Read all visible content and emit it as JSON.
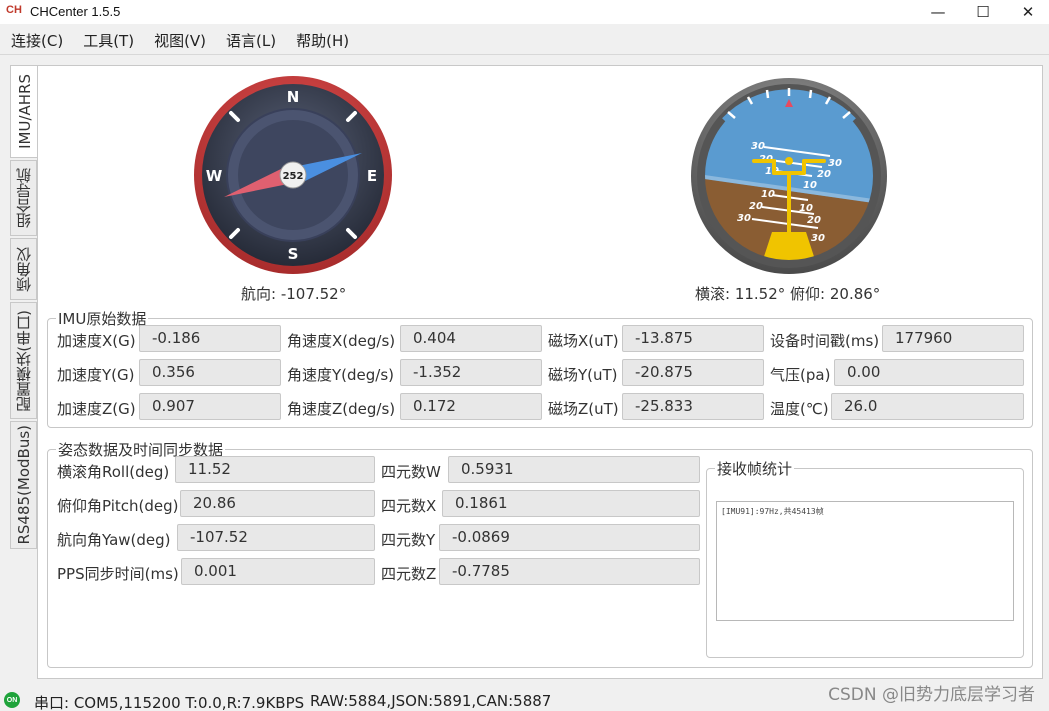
{
  "window": {
    "logo": "CH",
    "title": "CHCenter 1.5.5",
    "minimize_glyph": "—",
    "maximize_glyph": "☐",
    "close_glyph": "✕"
  },
  "menu": [
    "连接(C)",
    "工具(T)",
    "视图(V)",
    "语言(L)",
    "帮助(H)"
  ],
  "tabs": [
    "IMU/AHRS",
    "组合导航",
    "倾角仪",
    "配置模块(串口)",
    "RS485(ModBus)"
  ],
  "compass": {
    "heading_label": "航向: -107.52°",
    "center_value": "252",
    "cardinals": {
      "n": "N",
      "s": "S",
      "e": "E",
      "w": "W"
    }
  },
  "attitude": {
    "label": "横滚:   11.52° 俯仰:   20.86°",
    "pitch_ticks": [
      "30",
      "20",
      "10",
      "10",
      "20",
      "30",
      "30",
      "20",
      "10",
      "10",
      "20",
      "30"
    ]
  },
  "imu_raw": {
    "legend": "IMU原始数据",
    "rows": [
      [
        {
          "label": "加速度X(G)",
          "value": "-0.186"
        },
        {
          "label": "角速度X(deg/s)",
          "value": "0.404"
        },
        {
          "label": "磁场X(uT)",
          "value": "-13.875"
        },
        {
          "label": "设备时间戳(ms)",
          "value": "177960"
        }
      ],
      [
        {
          "label": "加速度Y(G)",
          "value": "0.356"
        },
        {
          "label": "角速度Y(deg/s)",
          "value": "-1.352"
        },
        {
          "label": "磁场Y(uT)",
          "value": "-20.875"
        },
        {
          "label": "气压(pa)",
          "value": "0.00"
        }
      ],
      [
        {
          "label": "加速度Z(G)",
          "value": "0.907"
        },
        {
          "label": "角速度Z(deg/s)",
          "value": "0.172"
        },
        {
          "label": "磁场Z(uT)",
          "value": "-25.833"
        },
        {
          "label": "温度(℃)",
          "value": "26.0"
        }
      ]
    ]
  },
  "attitude_data": {
    "legend": "姿态数据及时间同步数据",
    "rows": [
      [
        {
          "label": "横滚角Roll(deg)",
          "value": "11.52"
        },
        {
          "label": "四元数W",
          "value": "0.5931"
        }
      ],
      [
        {
          "label": "俯仰角Pitch(deg)",
          "value": "20.86"
        },
        {
          "label": "四元数X",
          "value": "0.1861"
        }
      ],
      [
        {
          "label": "航向角Yaw(deg)",
          "value": "-107.52"
        },
        {
          "label": "四元数Y",
          "value": "-0.0869"
        }
      ],
      [
        {
          "label": "PPS同步时间(ms)",
          "value": "0.001"
        },
        {
          "label": "四元数Z",
          "value": "-0.7785"
        }
      ]
    ]
  },
  "frame_stats": {
    "legend": "接收帧统计",
    "log": "[IMU91]:97Hz,共45413帧"
  },
  "status": {
    "led": "ON",
    "port": "串口: COM5,115200 T:0.0,R:7.9KBPS",
    "counts": "RAW:5884,JSON:5891,CAN:5887",
    "watermark": "CSDN @旧势力底层学习者"
  }
}
